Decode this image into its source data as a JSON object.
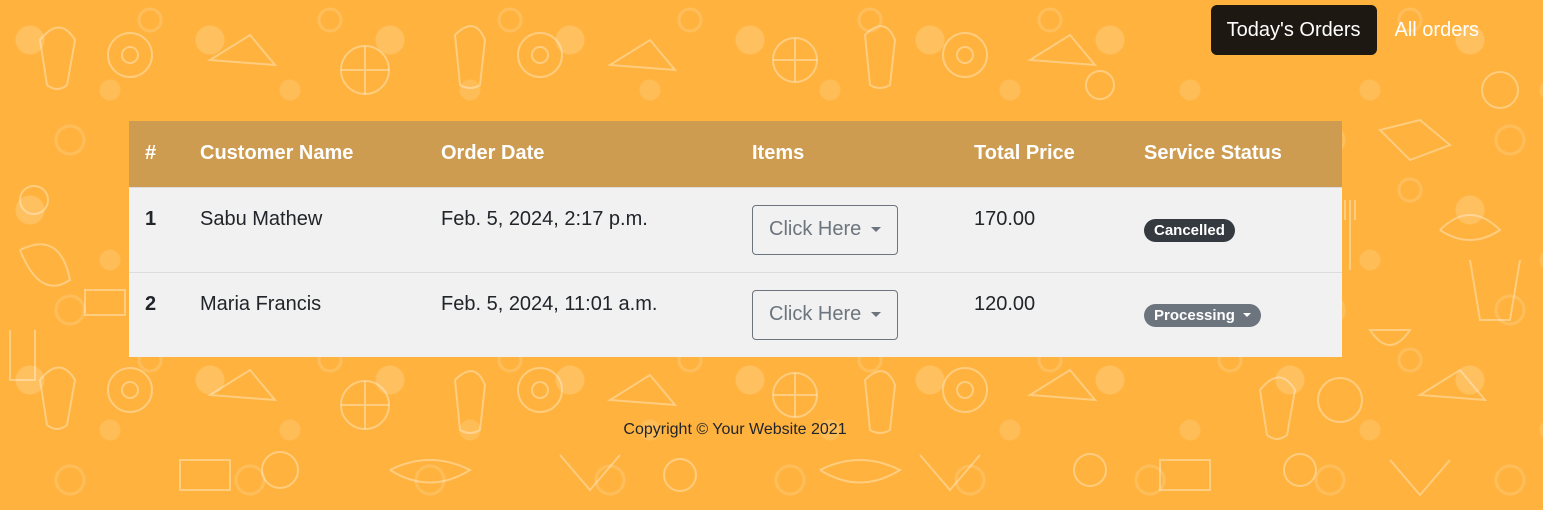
{
  "nav": {
    "items": [
      {
        "label": "Today's Orders",
        "active": true
      },
      {
        "label": "All orders",
        "active": false
      }
    ]
  },
  "table": {
    "headers": [
      "#",
      "Customer Name",
      "Order Date",
      "Items",
      "Total Price",
      "Service Status"
    ],
    "rows": [
      {
        "num": "1",
        "customer": "Sabu Mathew",
        "date": "Feb. 5, 2024, 2:17 p.m.",
        "items_label": "Click Here",
        "price": "170.00",
        "status": "Cancelled",
        "status_color": "#343a40",
        "status_dropdown": false
      },
      {
        "num": "2",
        "customer": "Maria Francis",
        "date": "Feb. 5, 2024, 11:01 a.m.",
        "items_label": "Click Here",
        "price": "120.00",
        "status": "Processing",
        "status_color": "#6c757d",
        "status_dropdown": true
      }
    ]
  },
  "footer": {
    "text": "Copyright © Your Website 2021"
  },
  "colors": {
    "background": "#ffb23d",
    "header": "#cd9c51",
    "nav_active": "#1e1812",
    "row_bg": "#f1f1f1"
  }
}
